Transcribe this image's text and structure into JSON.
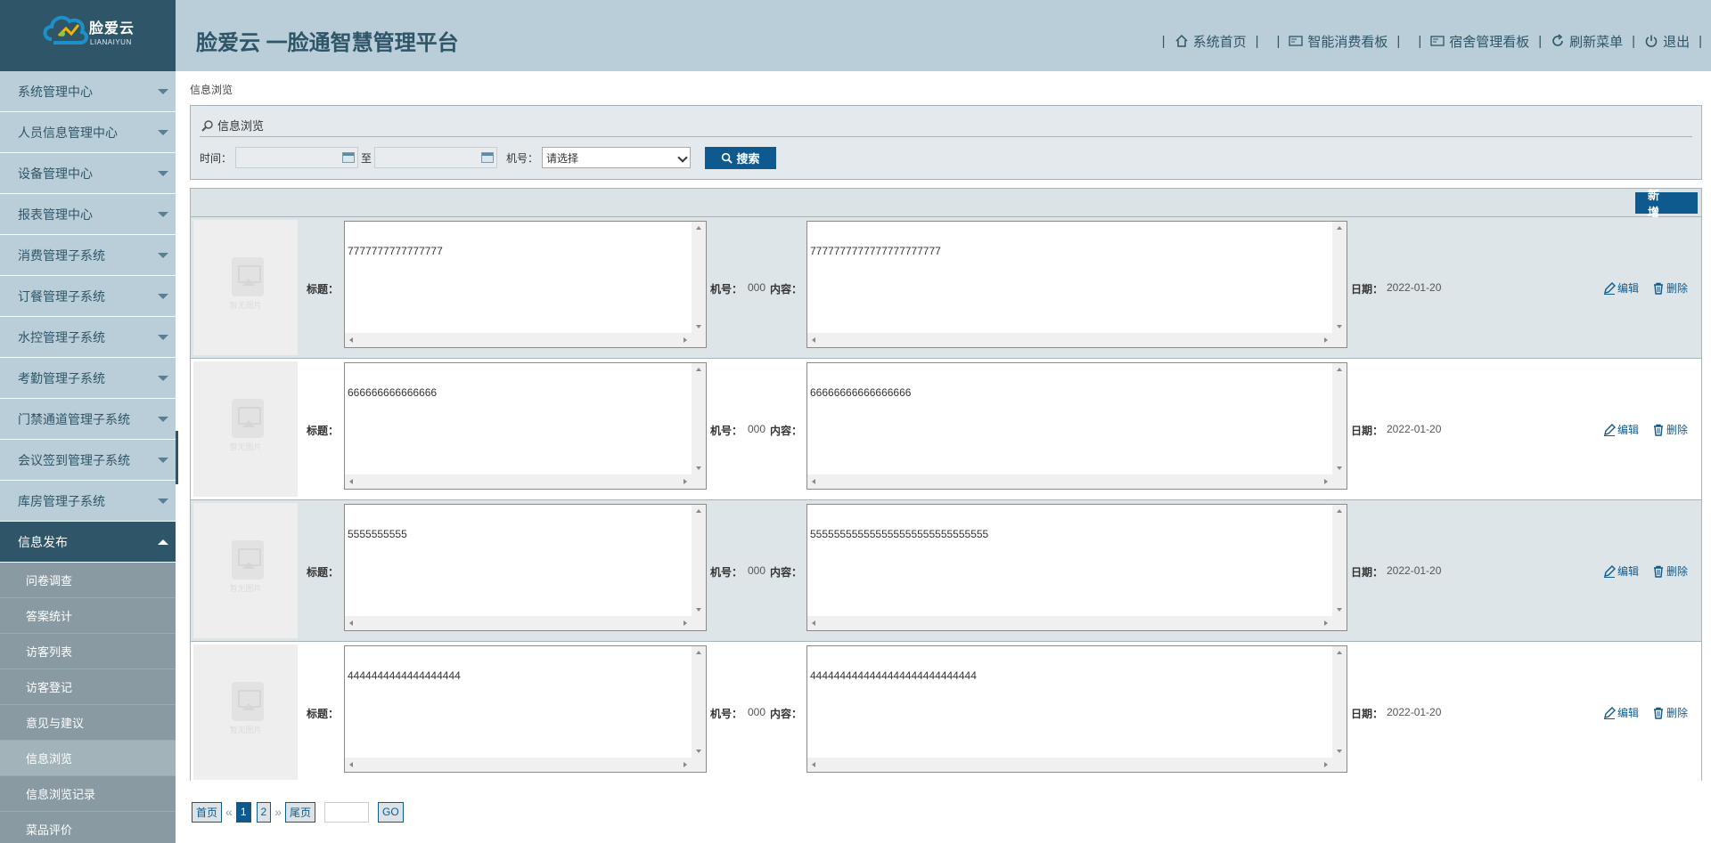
{
  "brand": {
    "name": "脸爱云",
    "sub": "LIANAIYUN",
    "title": "脸爱云 一脸通智慧管理平台"
  },
  "top_nav": [
    {
      "label": "系统首页",
      "icon": "home-icon"
    },
    {
      "label": "智能消费看板",
      "icon": "dashboard-icon"
    },
    {
      "label": "宿舍管理看板",
      "icon": "dashboard-icon"
    },
    {
      "label": "刷新菜单",
      "icon": "refresh-icon"
    },
    {
      "label": "退出",
      "icon": "power-icon"
    }
  ],
  "sidebar": {
    "items": [
      "系统管理中心",
      "人员信息管理中心",
      "设备管理中心",
      "报表管理中心",
      "消费管理子系统",
      "订餐管理子系统",
      "水控管理子系统",
      "考勤管理子系统",
      "门禁通道管理子系统",
      "会议签到管理子系统",
      "库房管理子系统"
    ],
    "active": "信息发布",
    "sub_items": [
      "问卷调查",
      "答案统计",
      "访客列表",
      "访客登记",
      "意见与建议",
      "信息浏览",
      "信息浏览记录",
      "菜品评价"
    ],
    "current_sub": "信息浏览"
  },
  "breadcrumb": "信息浏览",
  "search": {
    "panel_title": "信息浏览",
    "time_label": "时间：",
    "to_label": "至",
    "machine_label": "机号：",
    "machine_value": "请选择",
    "search_label": "搜索"
  },
  "toolbar": {
    "add_label": "新 增"
  },
  "labels": {
    "title": "标题：",
    "machine": "机号：",
    "content": "内容：",
    "date": "日期：",
    "edit": "编辑",
    "delete": "删除",
    "no_image": "暂无图片"
  },
  "rows": [
    {
      "title": "7777777777777777",
      "machine": "000",
      "content": "7777777777777777777777",
      "date": "2022-01-20"
    },
    {
      "title": "666666666666666",
      "machine": "000",
      "content": "66666666666666666",
      "date": "2022-01-20"
    },
    {
      "title": "5555555555",
      "machine": "000",
      "content": "555555555555555555555555555555",
      "date": "2022-01-20"
    },
    {
      "title": "4444444444444444444",
      "machine": "000",
      "content": "4444444444444444444444444444",
      "date": "2022-01-20"
    }
  ],
  "pager": {
    "first": "首页",
    "last": "尾页",
    "go": "GO",
    "pages": [
      "1",
      "2"
    ],
    "current": "1",
    "prev": "«",
    "next": "»"
  }
}
